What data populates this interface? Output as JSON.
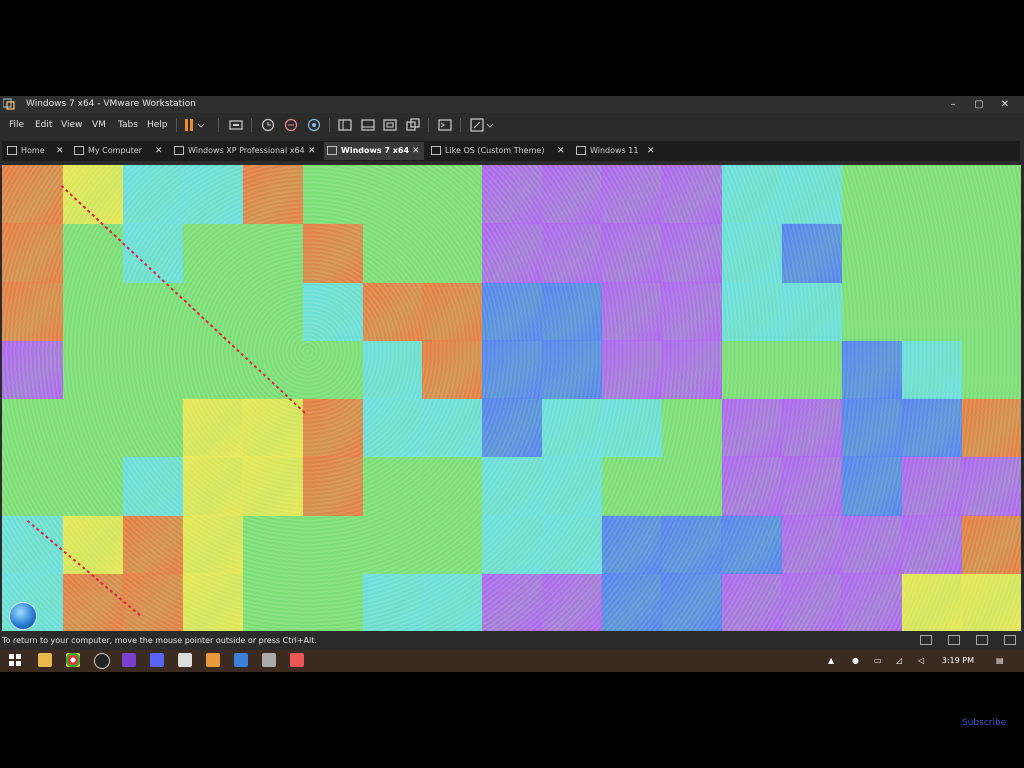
{
  "window": {
    "title": "Windows 7 x64 - VMware Workstation",
    "controls": [
      "–",
      "▢",
      "✕"
    ]
  },
  "menu": [
    "File",
    "Edit",
    "View",
    "VM",
    "Tabs",
    "Help"
  ],
  "tabs": [
    {
      "label": "Home",
      "icon": "home-icon",
      "active": false
    },
    {
      "label": "My Computer",
      "icon": "computer-icon",
      "active": false
    },
    {
      "label": "Windows XP Professional x64 ...",
      "icon": "vm-icon",
      "active": false
    },
    {
      "label": "Windows 7 x64",
      "icon": "vm-icon",
      "active": true
    },
    {
      "label": "Like OS (Custom Theme)",
      "icon": "vm-icon",
      "active": false
    },
    {
      "label": "Windows 11",
      "icon": "vm-icon",
      "active": false
    }
  ],
  "status": {
    "message": "To return to your computer, move the mouse pointer outside or press Ctrl+Alt."
  },
  "taskbar": {
    "time": "3:19 PM"
  },
  "overlay": {
    "subscribe": "Subscribe"
  },
  "colors": {
    "orange": "#e8804a",
    "green": "#7fe07a",
    "cyan": "#6fe0e0",
    "blue": "#5a86f0",
    "purple": "#b06af0",
    "yellow": "#e8e85a",
    "pink": "#e87ab4"
  }
}
